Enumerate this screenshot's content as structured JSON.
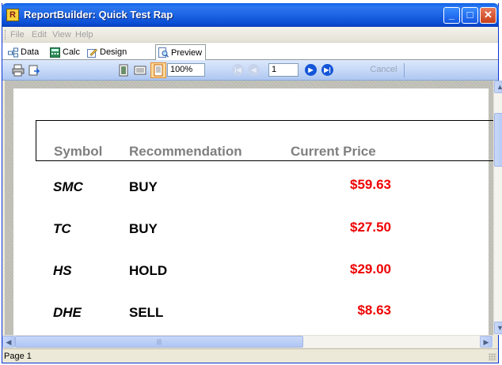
{
  "window": {
    "title": "ReportBuilder: Quick Test Rap",
    "icon_letter": "R",
    "minimize": "_",
    "maximize": "□",
    "close": "✕"
  },
  "menu": {
    "items": [
      "File",
      "Edit",
      "View",
      "Help"
    ]
  },
  "tabs": [
    {
      "label": "Data",
      "icon": "data-icon"
    },
    {
      "label": "Calc",
      "icon": "calc-icon"
    },
    {
      "label": "Design",
      "icon": "design-icon"
    },
    {
      "label": "Preview",
      "icon": "preview-icon",
      "active": true
    }
  ],
  "toolbar": {
    "zoom_value": "100%",
    "page_value": "1",
    "cancel_label": "Cancel"
  },
  "report": {
    "columns": [
      "Symbol",
      "Recommendation",
      "Current Price"
    ],
    "rows": [
      {
        "symbol": "SMC",
        "recommendation": "BUY",
        "price": "$59.63"
      },
      {
        "symbol": "TC",
        "recommendation": "BUY",
        "price": "$27.50"
      },
      {
        "symbol": "HS",
        "recommendation": "HOLD",
        "price": "$29.00"
      },
      {
        "symbol": "DHE",
        "recommendation": "SELL",
        "price": "$8.63"
      }
    ],
    "header_color": "#7f7f7f",
    "price_color": "#ee0000"
  },
  "scroll": {
    "up": "▲",
    "down": "▼",
    "left": "◀",
    "right": "▶",
    "thumb_grip": "|||"
  },
  "status": {
    "text": "Page 1"
  }
}
